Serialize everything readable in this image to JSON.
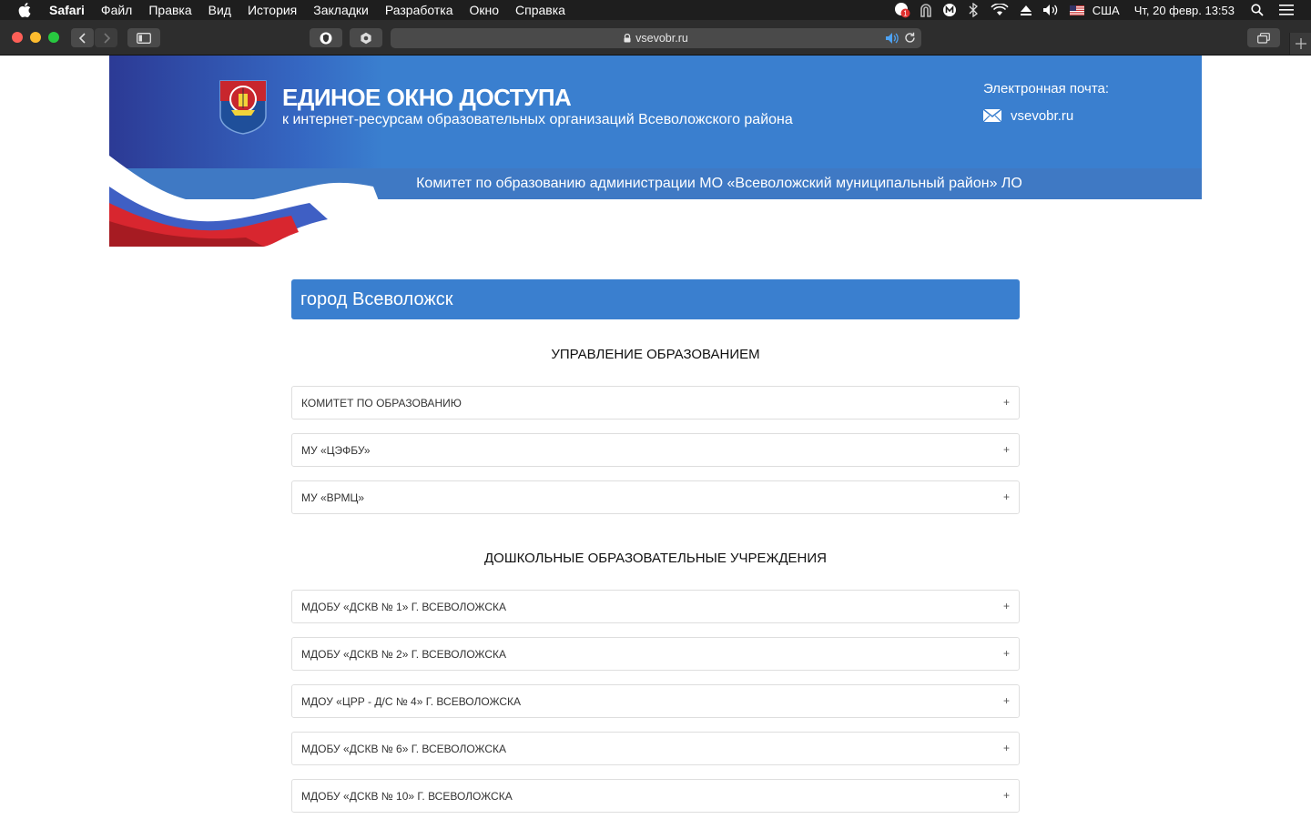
{
  "menubar": {
    "app": "Safari",
    "items": [
      "Файл",
      "Правка",
      "Вид",
      "История",
      "Закладки",
      "Разработка",
      "Окно",
      "Справка"
    ],
    "input_source": "США",
    "clock": "Чт, 20 февр.  13:53",
    "notification_badge": "1"
  },
  "browser": {
    "url": "vsevobr.ru"
  },
  "header": {
    "title": "ЕДИНОЕ ОКНО ДОСТУПА",
    "subtitle": "к интернет-ресурсам образовательных организаций Всеволожского района",
    "email_label": "Электронная почта:",
    "email": "vsevobr.ru",
    "committee": "Комитет по образованию администрации МО «Всеволожский муниципальный район» ЛО"
  },
  "main": {
    "city": "город Всеволожск",
    "sections": [
      {
        "title": "УПРАВЛЕНИЕ ОБРАЗОВАНИЕМ",
        "items": [
          "КОМИТЕТ ПО ОБРАЗОВАНИЮ",
          "МУ «ЦЭФБУ»",
          "МУ «ВРМЦ»"
        ]
      },
      {
        "title": "ДОШКОЛЬНЫЕ ОБРАЗОВАТЕЛЬНЫЕ УЧРЕЖДЕНИЯ",
        "items": [
          "МДОБУ «ДСКВ № 1» Г. ВСЕВОЛОЖСКА",
          "МДОБУ «ДСКВ № 2» Г. ВСЕВОЛОЖСКА",
          "МДОУ «ЦРР - Д/С № 4» Г. ВСЕВОЛОЖСКА",
          "МДОБУ «ДСКВ № 6» Г. ВСЕВОЛОЖСКА",
          "МДОБУ «ДСКВ № 10» Г. ВСЕВОЛОЖСКА"
        ]
      }
    ],
    "expand_symbol": "+"
  },
  "colors": {
    "primary_blue": "#3a7fcf",
    "dark_blue": "#2c3a95",
    "flag_red": "#d8262f",
    "flag_white": "#ffffff"
  }
}
